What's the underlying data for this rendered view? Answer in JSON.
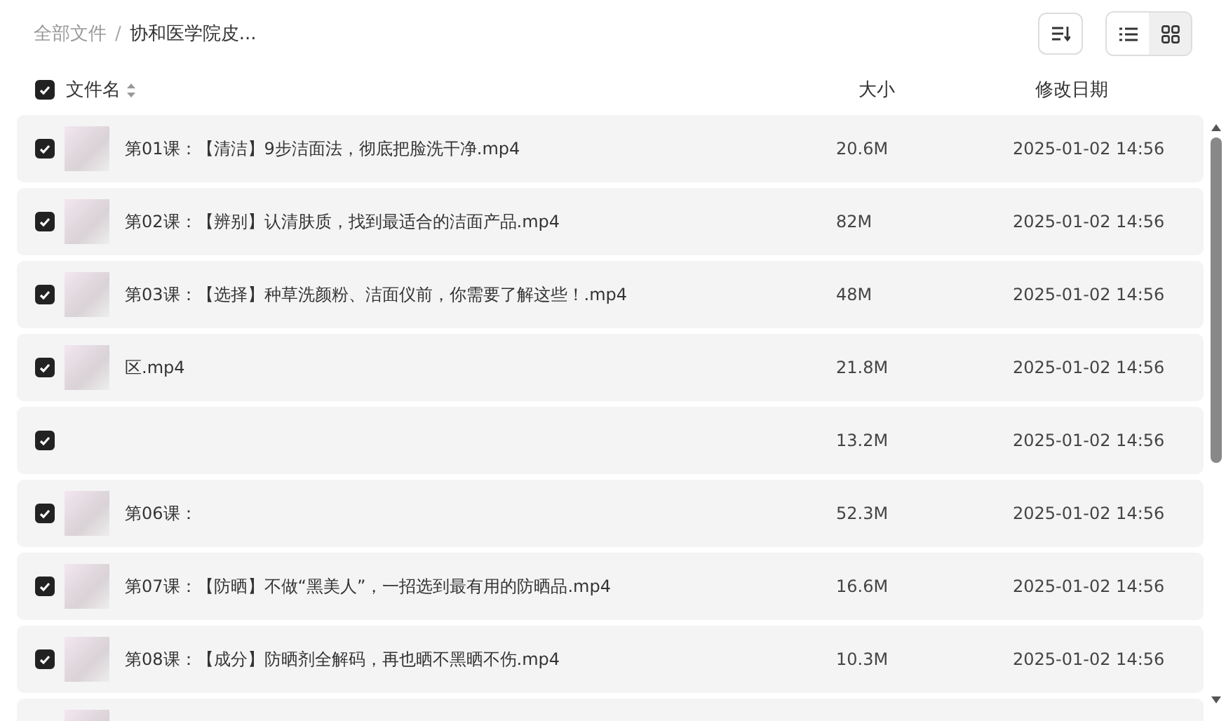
{
  "breadcrumb": [
    {
      "label": "全部文件",
      "current": false
    },
    {
      "label": "协和医学院皮...",
      "current": true
    }
  ],
  "breadcrumb_separator": "/",
  "view_toggle": [
    {
      "kind": "list",
      "selected": false
    },
    {
      "kind": "grid",
      "selected": true
    }
  ],
  "table": {
    "select_all": {
      "checked": true
    },
    "columns": [
      "文件名",
      "大小",
      "修改日期"
    ],
    "rows": [
      {
        "checked": true,
        "thumbnail": true,
        "name": "第01课：【清洁】9步洁面法，彻底把脸洗干净.mp4",
        "size": "20.6M",
        "modified": "2025-01-02 14:56"
      },
      {
        "checked": true,
        "thumbnail": true,
        "name": "第02课：【辨别】认清肤质，找到最适合的洁面产品.mp4",
        "size": "82M",
        "modified": "2025-01-02 14:56"
      },
      {
        "checked": true,
        "thumbnail": true,
        "name": "第03课：【选择】种草洗颜粉、洁面仪前，你需要了解这些！.mp4",
        "size": "48M",
        "modified": "2025-01-02 14:56"
      },
      {
        "checked": true,
        "thumbnail": true,
        "name": "区.mp4",
        "size": "21.8M",
        "modified": "2025-01-02 14:56"
      },
      {
        "checked": true,
        "thumbnail": false,
        "size": "13.2M",
        "modified": "2025-01-02 14:56"
      },
      {
        "checked": true,
        "thumbnail": true,
        "name": "第06课：",
        "size": "52.3M",
        "modified": "2025-01-02 14:56"
      },
      {
        "checked": true,
        "thumbnail": true,
        "name": "第07课：【防晒】不做“黑美人”，一招选到最有用的防晒品.mp4",
        "size": "16.6M",
        "modified": "2025-01-02 14:56"
      },
      {
        "checked": true,
        "thumbnail": true,
        "name": "第08课：【成分】防晒剂全解码，再也晒不黑晒不伤.mp4",
        "size": "10.3M",
        "modified": "2025-01-02 14:56"
      },
      {
        "thumbnail": true
      }
    ]
  }
}
